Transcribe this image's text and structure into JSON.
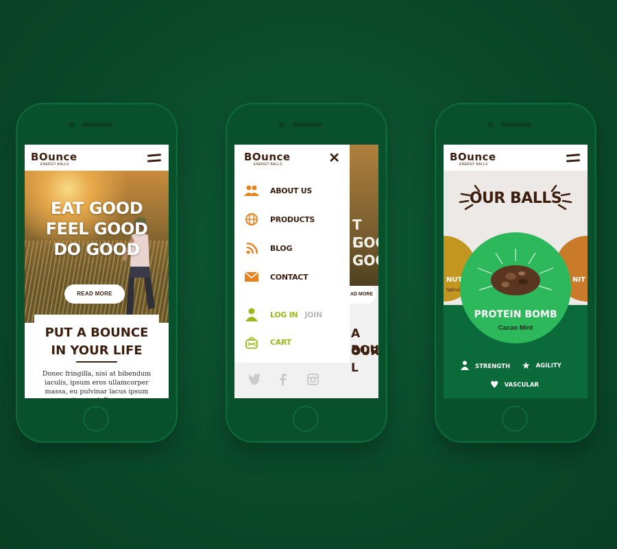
{
  "brand": {
    "name": "BOunce",
    "tagline": "ENERGY BALLS"
  },
  "colors": {
    "background": "#0a4a2b",
    "phone": "#08512c",
    "brown": "#3b1e0e",
    "orange": "#e4831f",
    "lime": "#9bb81c",
    "green": "#2db85b"
  },
  "screen1": {
    "hero_title": [
      "EAT GOOD",
      "FEEL GOOD",
      "DO GOOD"
    ],
    "read_more": "READ MORE",
    "section_title": [
      "PUT A BOUNCE",
      "IN YOUR LIFE"
    ],
    "body_text": "Donec fringilla, nisi at bibendum iaculis, ipsum eros ullamcorper massa, eu pulvinar lacus ipsum vitae orci. Donec"
  },
  "screen2": {
    "menu": [
      {
        "label": "ABOUT US",
        "icon": "people-icon"
      },
      {
        "label": "PRODUCTS",
        "icon": "globe-icon"
      },
      {
        "label": "BLOG",
        "icon": "rss-icon"
      },
      {
        "label": "CONTACT",
        "icon": "envelope-icon"
      }
    ],
    "login": "LOG IN",
    "join": "JOIN",
    "cart": "CART",
    "social": [
      "twitter-icon",
      "facebook-icon",
      "instagram-icon"
    ],
    "under_hero": [
      "T GOO",
      "L GO",
      "GOO"
    ],
    "under_read_more": "AD MORE",
    "under_title": [
      "A BOU",
      "OUR L"
    ]
  },
  "screen3": {
    "title": "OUR BALLS",
    "left_ball_label": "NUTRI",
    "left_ball_sub": "Spirulina",
    "right_ball_label": "NIT",
    "product_name": "PROTEIN BOMB",
    "product_flavor": "Cacao Mint",
    "attributes": [
      {
        "label": "STRENGTH",
        "icon": "person-icon"
      },
      {
        "label": "AGILITY",
        "icon": "star-icon"
      },
      {
        "label": "VASCULAR",
        "icon": "heart-icon"
      }
    ]
  }
}
